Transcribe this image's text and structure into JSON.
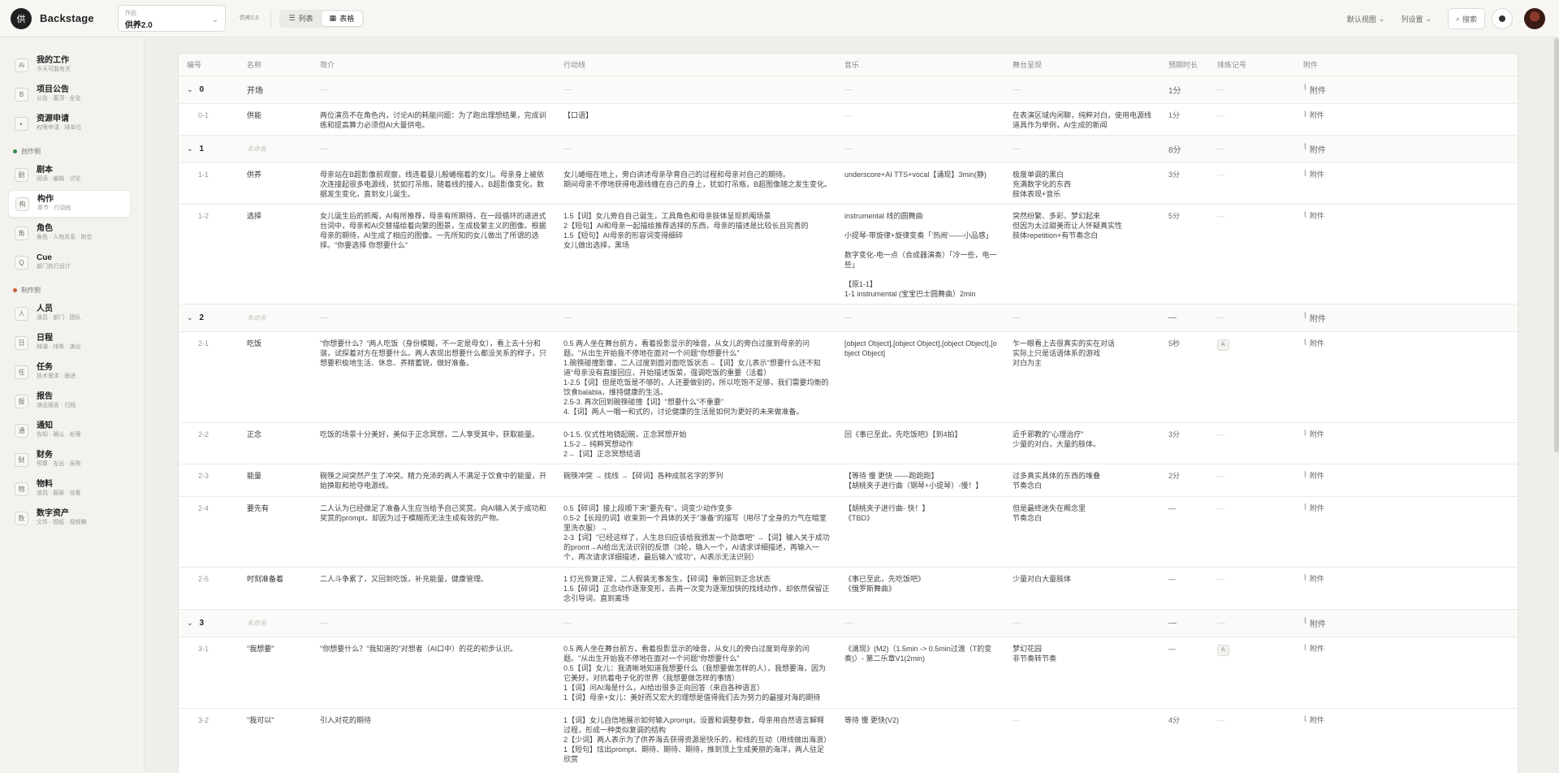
{
  "app": {
    "logo_char": "供",
    "brand": "Backstage"
  },
  "work_select": {
    "label": "作品",
    "value": "供养2.0"
  },
  "breadcrumb": {
    "sub": "供养2.0",
    "main": "构作"
  },
  "view_toggle": [
    {
      "label": "列表",
      "icon": "list-icon"
    },
    {
      "label": "表格",
      "icon": "grid-icon"
    }
  ],
  "top_right": {
    "default_view": "默认视图",
    "column_settings": "列设置",
    "search": "搜索"
  },
  "sidebar": {
    "top": [
      {
        "icon": "Ai",
        "title": "我的工作",
        "sub": "今天可能有关"
      },
      {
        "icon": "B",
        "title": "项目公告",
        "sub": "公告 · 置顶 · 全览"
      },
      {
        "icon": "◐",
        "title": "资源申请",
        "sub": "权限申请 · 排单位"
      }
    ],
    "group1": {
      "label": "创作侧",
      "color": "#3a8a4a"
    },
    "creative": [
      {
        "icon": "剧",
        "title": "剧本",
        "sub": "阅读 · 编辑 · 讨论"
      },
      {
        "icon": "构",
        "title": "构作",
        "sub": "章节 · 行动线"
      },
      {
        "icon": "角",
        "title": "角色",
        "sub": "角色 · 人物关系 · 附合"
      },
      {
        "icon": "Q",
        "title": "Cue",
        "sub": "部门执行设计"
      }
    ],
    "group2": {
      "label": "制作侧",
      "color": "#c8613a"
    },
    "production": [
      {
        "icon": "人",
        "title": "人员",
        "sub": "演员 · 部门 · 团队"
      },
      {
        "icon": "日",
        "title": "日程",
        "sub": "排课 · 排练 · 演出"
      },
      {
        "icon": "任",
        "title": "任务",
        "sub": "技术需求 · 跟进"
      },
      {
        "icon": "报",
        "title": "报告",
        "sub": "演出报告 · 归档"
      },
      {
        "icon": "通",
        "title": "通知",
        "sub": "告知 · 确认 · 处理"
      },
      {
        "icon": "财",
        "title": "财务",
        "sub": "预算 · 支出 · 采购"
      },
      {
        "icon": "物",
        "title": "物料",
        "sub": "道具 · 服装 · 设备"
      },
      {
        "icon": "数",
        "title": "数字资产",
        "sub": "文件 · 图纸 · 视频稿"
      }
    ]
  },
  "table": {
    "headers": [
      "编号",
      "名称",
      "简介",
      "行动线",
      "音乐",
      "舞台呈现",
      "预期时长",
      "排练记号",
      "附件"
    ],
    "empty_name": "未命名",
    "attachment_label": "附件",
    "rows": [
      {
        "type": "group",
        "num": "0",
        "name": "开场",
        "duration": "1分"
      },
      {
        "type": "row",
        "num": "0-1",
        "name": "供能",
        "intro": "两位演员不在角色内，讨论AI的耗能问题：为了跑出理想结果，完成训练和提高算力必须但AI大量供电。",
        "action": "【口语】",
        "music": "—",
        "stage": "在表演区域内闲聊，纯粹对白，使用电源线道具作为举例，AI生成的新闻",
        "duration": "1分",
        "mark": "—"
      },
      {
        "type": "group",
        "num": "1",
        "name": "",
        "duration": "8分"
      },
      {
        "type": "row",
        "num": "1-1",
        "name": "供养",
        "intro": "母亲站在B超影像前观察，线连着婴儿般蜷缩着的女儿。母亲身上被依次连接起很多电源线，犹如打吊瓶，随着线的接入，B超影像变化，数据发生变化，直到女儿诞生。",
        "action": "女儿蜷缩在地上，旁白讲述母亲孕育自己的过程和母亲对自己的期待。\n期间母亲不停地获得电源线缠在自己的身上，犹如打吊瓶，B超图像随之发生变化。",
        "music": "underscore+AI TTS+vocal【诵现】3min(静)",
        "stage": "极度单调的黑白\n充满数字化的东西\n肢体表现+音乐",
        "duration": "3分",
        "mark": "—"
      },
      {
        "type": "row",
        "num": "1-2",
        "name": "选择",
        "intro": "女儿诞生后的抓阄，AI有所推荐，母亲有所期待，在一段循环的递进式台词中，母亲和AI交替描绘着向繁的图景，生成极繁主义的图像。根据母亲的期待，AI生成了相应的图像。一先所知的女儿做出了所谓的选择。\"你要选择 你想要什么\"",
        "action": "1.5【词】女儿旁自自己诞生，工具角色和母亲肢体呈现抓阄场景\n2【短句】AI和母亲一起描绘推荐选择的东西，母亲的描述是比较长且完善的\n1.5【短句】AI母亲的形容词变得细碎\n女儿做出选择，黑场",
        "music": "instrumental 线的圆舞曲\n\n小提琴-带旋律+旋律变奏「'热闹'——小品感」\n\n数字变化-电一点（合成器演奏）「冷一些，电一些」\n\n【原1-1】\n1-1 instrumental (宝宝巴士圆舞曲）2min",
        "stage": "突然纷繁、多彩、梦幻起来\n但因为太过甜美而让人怀疑真实性\n肢体repetition+有节奏念白",
        "duration": "5分",
        "mark": "—"
      },
      {
        "type": "group",
        "num": "2",
        "name": "",
        "duration": "—"
      },
      {
        "type": "row",
        "num": "2-1",
        "name": "吃饭",
        "intro": "\"你想要什么？\"两人吃饭（身份模糊，不一定是母女），看上去十分和谐，试探着对方在想要什么。两人表现出想要什么都没关系的样子，只想要积极地生活、休息、养精蓄锐，做好准备。",
        "action": "0.5 两人坐在舞台前方，看着投影显示的噪音，从女儿的旁白过度到母亲的问题。\"从出生开始我不停地在面对一个问题\"你想要什么\"\n1.碗筷碰撞影像，二人过度到面对面吃饭状态→【词】女儿表示\"想要什么还不知道\"母亲没有直接回应，开始描述饭菜，强调吃饭的重要（活着）\n1-2.5【词】但是吃饭是不够的，人还要做别的，所以吃饱不足够，我们需要均衡的饮食balabla，维持健康的生活。\n2.5-3. 再次回到碗筷碰撞【词】\"想要什么\"不重要\"\n4.【词】两人一唱一和式的，讨论健康的生活是如何为更好的未来做准备。",
        "music": "[object Object],[object Object],[object Object],[object Object]",
        "stage": "乍一眼看上去很真实的实在对话\n实际上只是话语体系的游戏\n对白为主",
        "duration": "5秒",
        "mark": "A"
      },
      {
        "type": "row",
        "num": "2-2",
        "name": "正念",
        "intro": "吃饭的场景十分美好，美似于正念冥想，二人享受其中，获取能量。",
        "action": "0-1.5. 仪式性地镜起碗，正念冥想开始\n1.5-2→ 纯粹冥想动作\n2→【词】正念冥想结语",
        "music": "回《事已至此，先吃饭吧》【到4拍】",
        "stage": "近乎邪教的\"心理治疗\"\n少量的对白，大量的肢体。",
        "duration": "3分",
        "mark": "—"
      },
      {
        "type": "row",
        "num": "2-3",
        "name": "能量",
        "intro": "碗筷之间突然产生了冲突。精力充沛的两人不满足于饮食中的能量，开始换取和抢夺电源线。",
        "action": "碗筷冲突 → 找线 →【碎词】各种成就名字的罗列",
        "music": "【等待 慢 更快 ——跑跑跑】\n【胡桃夹子进行曲（钢琴+小提琴）-慢！】",
        "stage": "过多真实具体的东西的堆叠\n节奏念白",
        "duration": "2分",
        "mark": "—"
      },
      {
        "type": "row",
        "num": "2-4",
        "name": "要先有",
        "intro": "二人认为已经做足了准备人生应当给予自己奖赏。向AI输入关于成功和奖赏的prompt，却因为过于模糊而无法生成有效的产物。",
        "action": "0.5【碎词】接上段顺下来\"要先有\"，词变少动作变多\n0.5-2【长段的词】收束到一个具体的关于\"准备\"的描写（用尽了全身的力气在暗室里洗衣服）→\n2-3【词】\"已经这样了，人生总归应该给我颁发一个勋章吧\" →【词】输入关于成功的promt→AI给出无法识别的反馈（3轮，输入一个，AI请求详细描述，再输入一个，再次请求详细描述，最后输入\"成功\"，AI表示无法识别）",
        "music": "【胡桃夹子进行曲- 快！】\n《TBD》",
        "stage": "但是最终迷失在概念里\n节奏念白",
        "duration": "—",
        "mark": "—"
      },
      {
        "type": "row",
        "num": "2-5",
        "name": "时刻准备着",
        "intro": "二人斗争累了，又回到吃饭，补充能量，健康管理。",
        "action": "1 灯光恢复正常，二人假装无事发生，【碎词】重新回到正念状态\n1.5【碎词】正念动作逐渐变形，去再一次变为逐渐加快的找线动作，却依然保留正念引导词，直到离场",
        "music": "《事已至此，先吃饭吧》\n《俄罗斯舞曲》",
        "stage": "少量对白大量肢体",
        "duration": "—",
        "mark": "—"
      },
      {
        "type": "group",
        "num": "3",
        "name": "",
        "duration": "—"
      },
      {
        "type": "row",
        "num": "3-1",
        "name": "\"我想要\"",
        "intro": "\"你想要什么？\"我知道的\"对想者（AI口中）的花的初步认识。",
        "action": "0.5 两人坐在舞台前方，看着投影显示的噪音，从女儿的旁白过度到母亲的问题。\"从出生开始我不停地在面对一个问题\"你想要什么\"\n0.5【词】女儿：我清晰地知道我想要什么（我想要做怎样的人），我想要海，因为它美好，对抗着电子化的世界（我想要做怎样的事情）\n1【词】问AI海是什么，AI给出很多正向回答（来自各种语言）\n1【词】母亲+女儿：美好而又宏大的理想是值得我们去为努力的最接对海的期待",
        "music": "《滴现》(M2)（1.5min -> 0.5min过渡（T的变奏)）- 第二乐章V1(2min)",
        "stage": "梦幻花园\n非节奏转节奏",
        "duration": "—",
        "mark": "A"
      },
      {
        "type": "row",
        "num": "3-2",
        "name": "\"我可以\"",
        "intro": "引入对花的期待",
        "action": "1【词】女儿自信地展示如何输入prompt，设置和调整参数，母亲用自然语言解释过程，形成一种类似复调的结构\n2【少词】两人表示为了供养海去获得资源是快乐的，和线的互动（用线做出海浪）\n1【短句】炫出prompt、期待、期待、期待，推到顶上生成美丽的海洋，两人驻足欣赏",
        "music": "等待 慢 更快(V2)",
        "stage": "—",
        "duration": "4分",
        "mark": "—"
      }
    ]
  }
}
